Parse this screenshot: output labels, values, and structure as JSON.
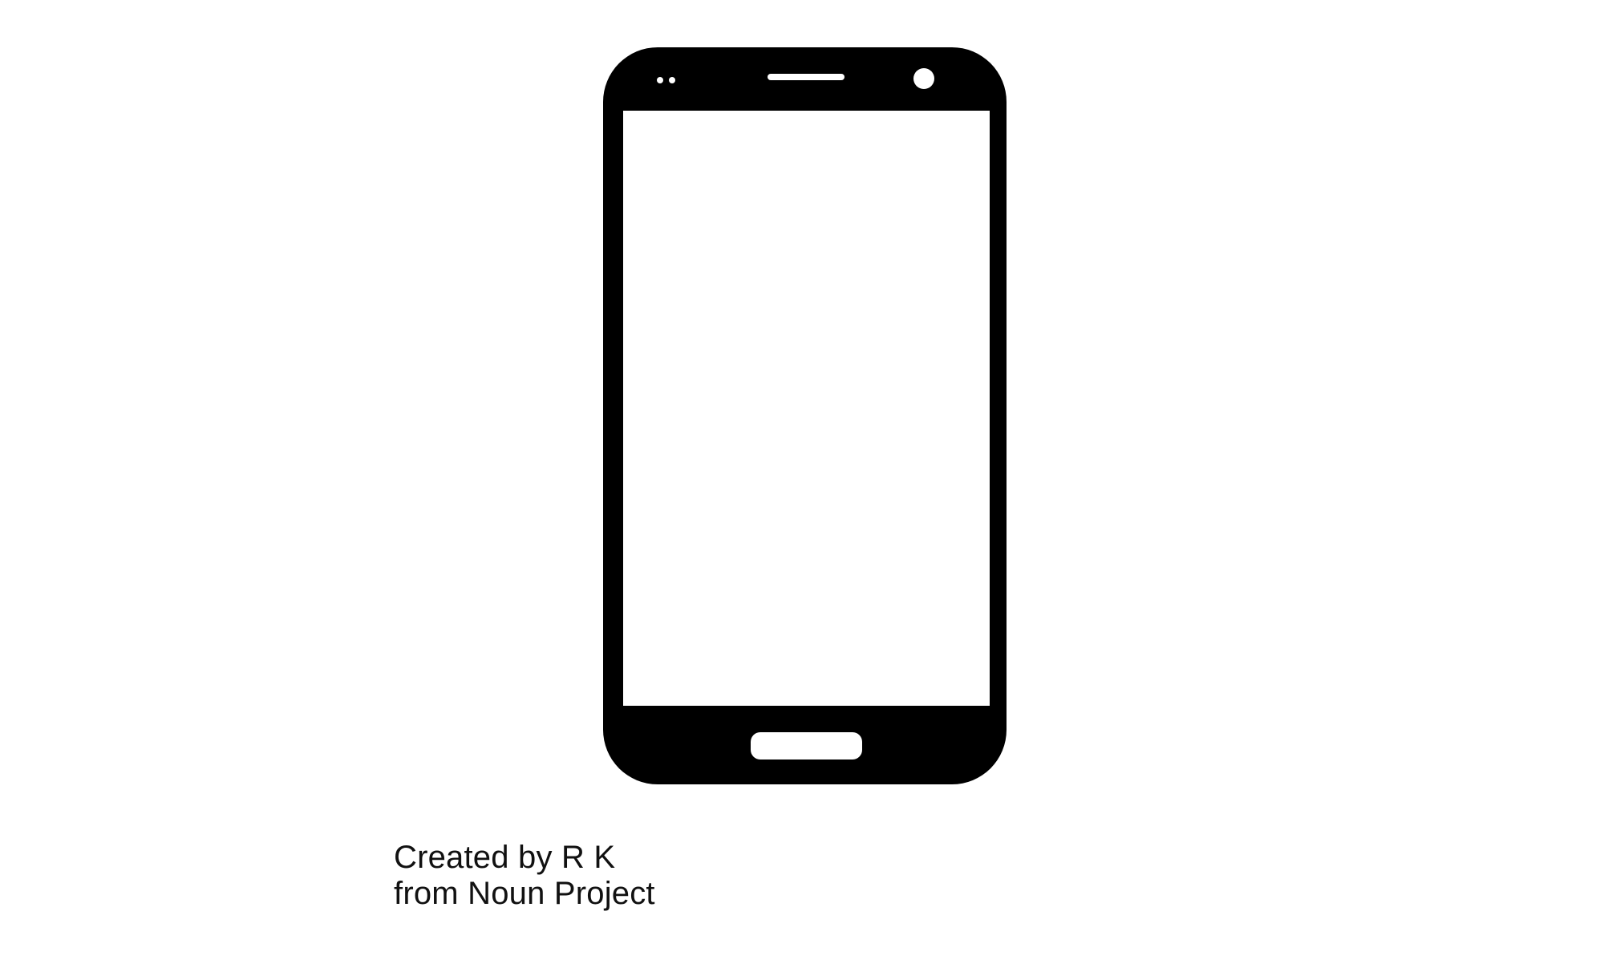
{
  "icon": {
    "name": "smartphone-icon",
    "fill": "#000000",
    "screen_color": "#ffffff",
    "background": "#ffffff"
  },
  "credit": {
    "line1": "Created by R K",
    "line2": "from Noun Project"
  }
}
